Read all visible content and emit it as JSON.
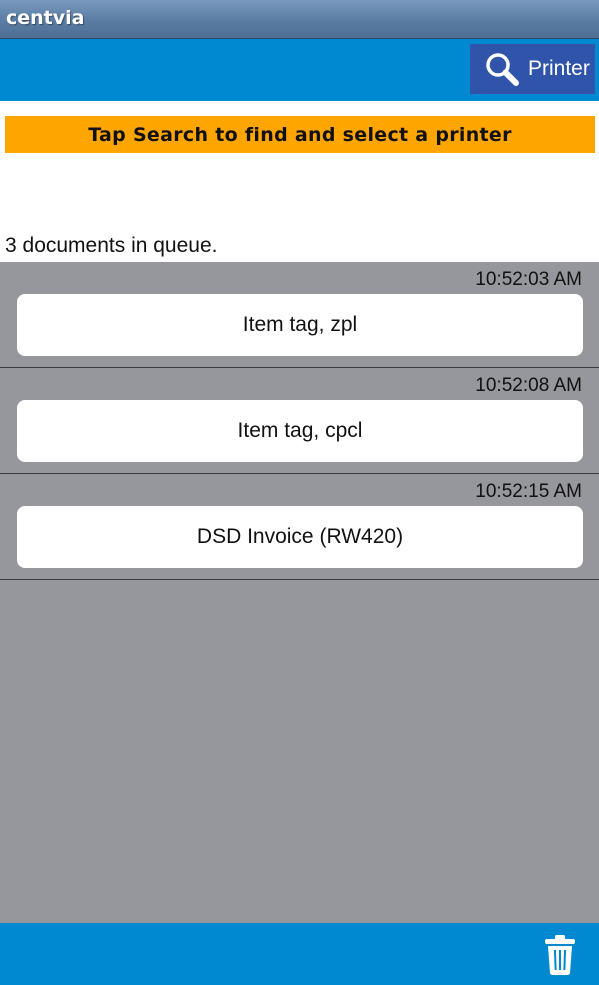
{
  "app": {
    "title": "centvia"
  },
  "toolbar": {
    "printer_label": "Printer"
  },
  "banner": {
    "text": "Tap Search to find and select a printer"
  },
  "queue": {
    "count_text": "3 documents in queue.",
    "items": [
      {
        "time": "10:52:03 AM",
        "label": "Item tag, zpl"
      },
      {
        "time": "10:52:08 AM",
        "label": "Item tag, cpcl"
      },
      {
        "time": "10:52:15 AM",
        "label": "DSD Invoice (RW420)"
      }
    ]
  },
  "icons": {
    "search": "search-icon",
    "trash": "trash-icon"
  },
  "colors": {
    "title_bar": "#5a7ca3",
    "toolbar": "#0088d1",
    "printer_button": "#2f54a9",
    "banner": "#ffa500",
    "list_background": "#96979c"
  }
}
